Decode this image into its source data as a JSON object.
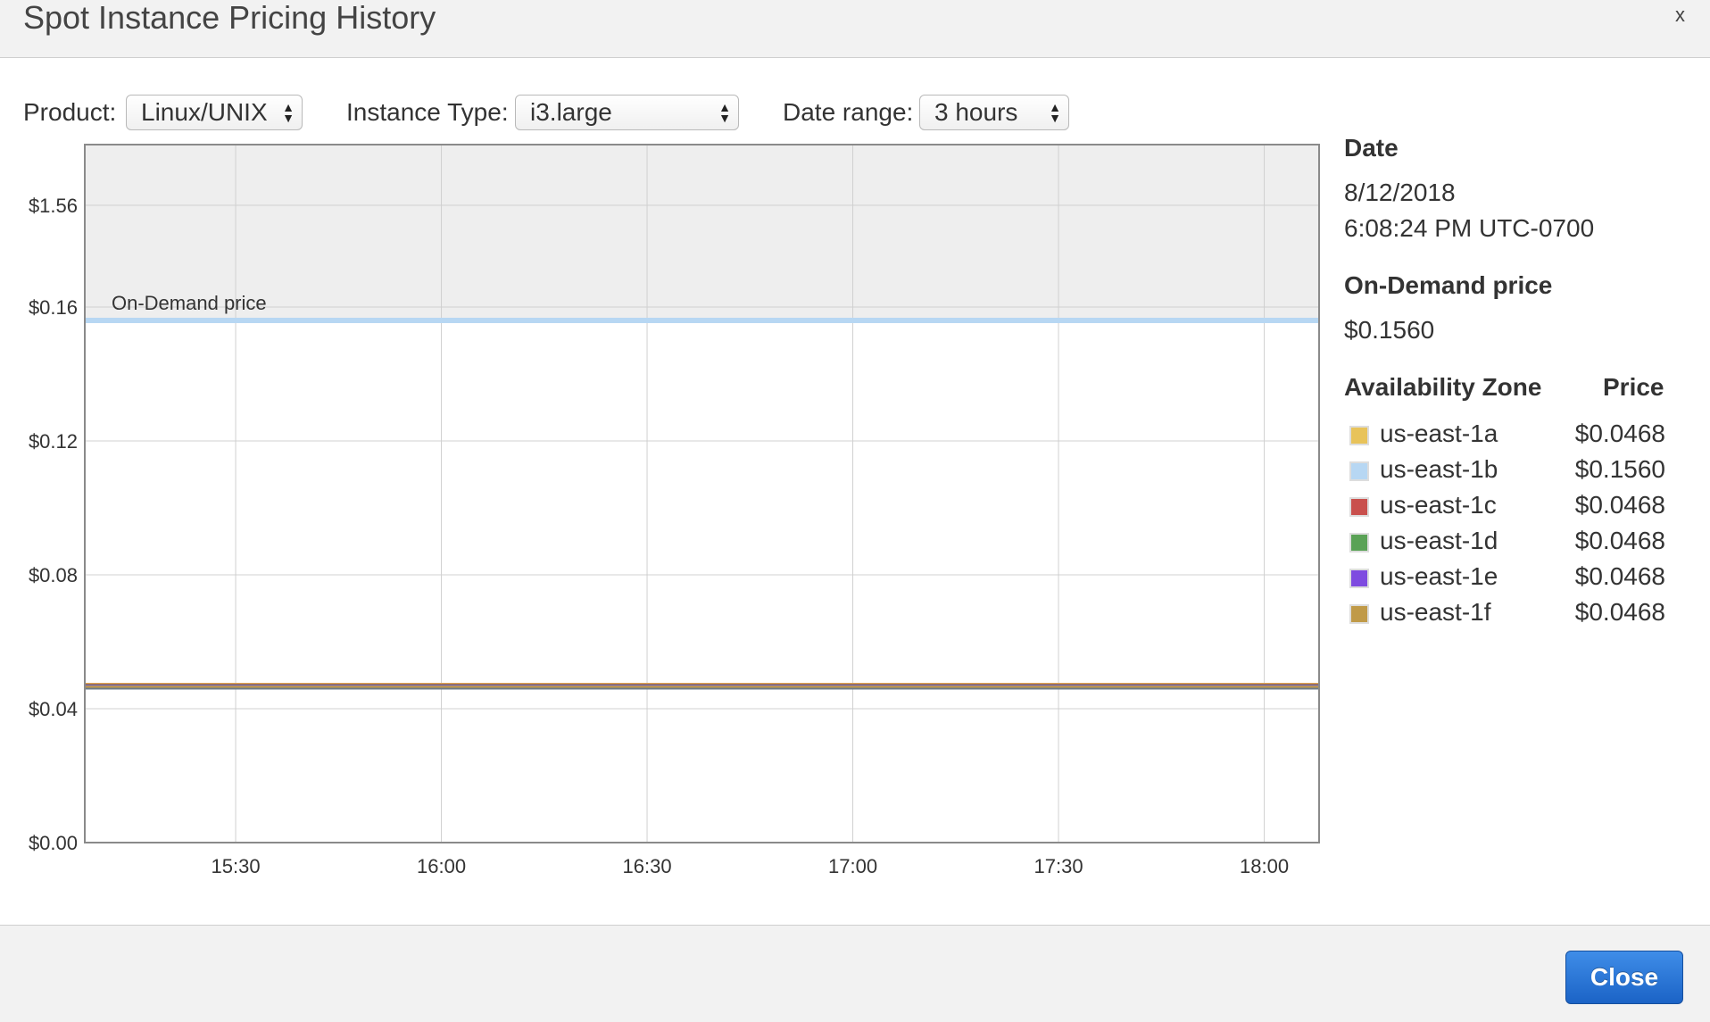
{
  "dialog": {
    "title": "Spot Instance Pricing History",
    "close_x": "x",
    "close_button": "Close"
  },
  "controls": {
    "product_label": "Product:",
    "product_value": "Linux/UNIX",
    "instance_type_label": "Instance Type:",
    "instance_type_value": "i3.large",
    "date_range_label": "Date range:",
    "date_range_value": "3 hours"
  },
  "side": {
    "date_heading": "Date",
    "date_value": "8/12/2018",
    "time_value": "6:08:24 PM UTC-0700",
    "ondemand_heading": "On-Demand price",
    "ondemand_value": "$0.1560",
    "az_heading": "Availability Zone",
    "price_heading": "Price",
    "zones": [
      {
        "name": "us-east-1a",
        "price": "$0.0468",
        "color": "#e8c35a"
      },
      {
        "name": "us-east-1b",
        "price": "$0.1560",
        "color": "#b7d7f3"
      },
      {
        "name": "us-east-1c",
        "price": "$0.0468",
        "color": "#c9504d"
      },
      {
        "name": "us-east-1d",
        "price": "$0.0468",
        "color": "#5aa256"
      },
      {
        "name": "us-east-1e",
        "price": "$0.0468",
        "color": "#7e4be0"
      },
      {
        "name": "us-east-1f",
        "price": "$0.0468",
        "color": "#c09a48"
      }
    ]
  },
  "chart_data": {
    "type": "line",
    "ondemand_label": "On-Demand price",
    "ondemand_price": 0.156,
    "y_ticks": [
      {
        "label": "$0.00",
        "value": 0
      },
      {
        "label": "$0.04",
        "value": 0.04
      },
      {
        "label": "$0.08",
        "value": 0.08
      },
      {
        "label": "$0.12",
        "value": 0.12
      },
      {
        "label": "$0.16",
        "value": 0.16
      },
      {
        "label": "$1.56",
        "value": 1.56
      }
    ],
    "x_ticks": [
      "15:30",
      "16:00",
      "16:30",
      "17:00",
      "17:30",
      "18:00"
    ],
    "x_range": [
      "15:08",
      "18:08"
    ],
    "grid": true,
    "series": [
      {
        "name": "us-east-1a",
        "value": 0.0468,
        "color": "#e8c35a"
      },
      {
        "name": "us-east-1b",
        "value": 0.156,
        "color": "#b7d7f3"
      },
      {
        "name": "us-east-1c",
        "value": 0.0468,
        "color": "#c9504d"
      },
      {
        "name": "us-east-1d",
        "value": 0.0468,
        "color": "#5aa256"
      },
      {
        "name": "us-east-1e",
        "value": 0.0468,
        "color": "#7e4be0"
      },
      {
        "name": "us-east-1f",
        "value": 0.0468,
        "color": "#c09a48"
      }
    ]
  }
}
